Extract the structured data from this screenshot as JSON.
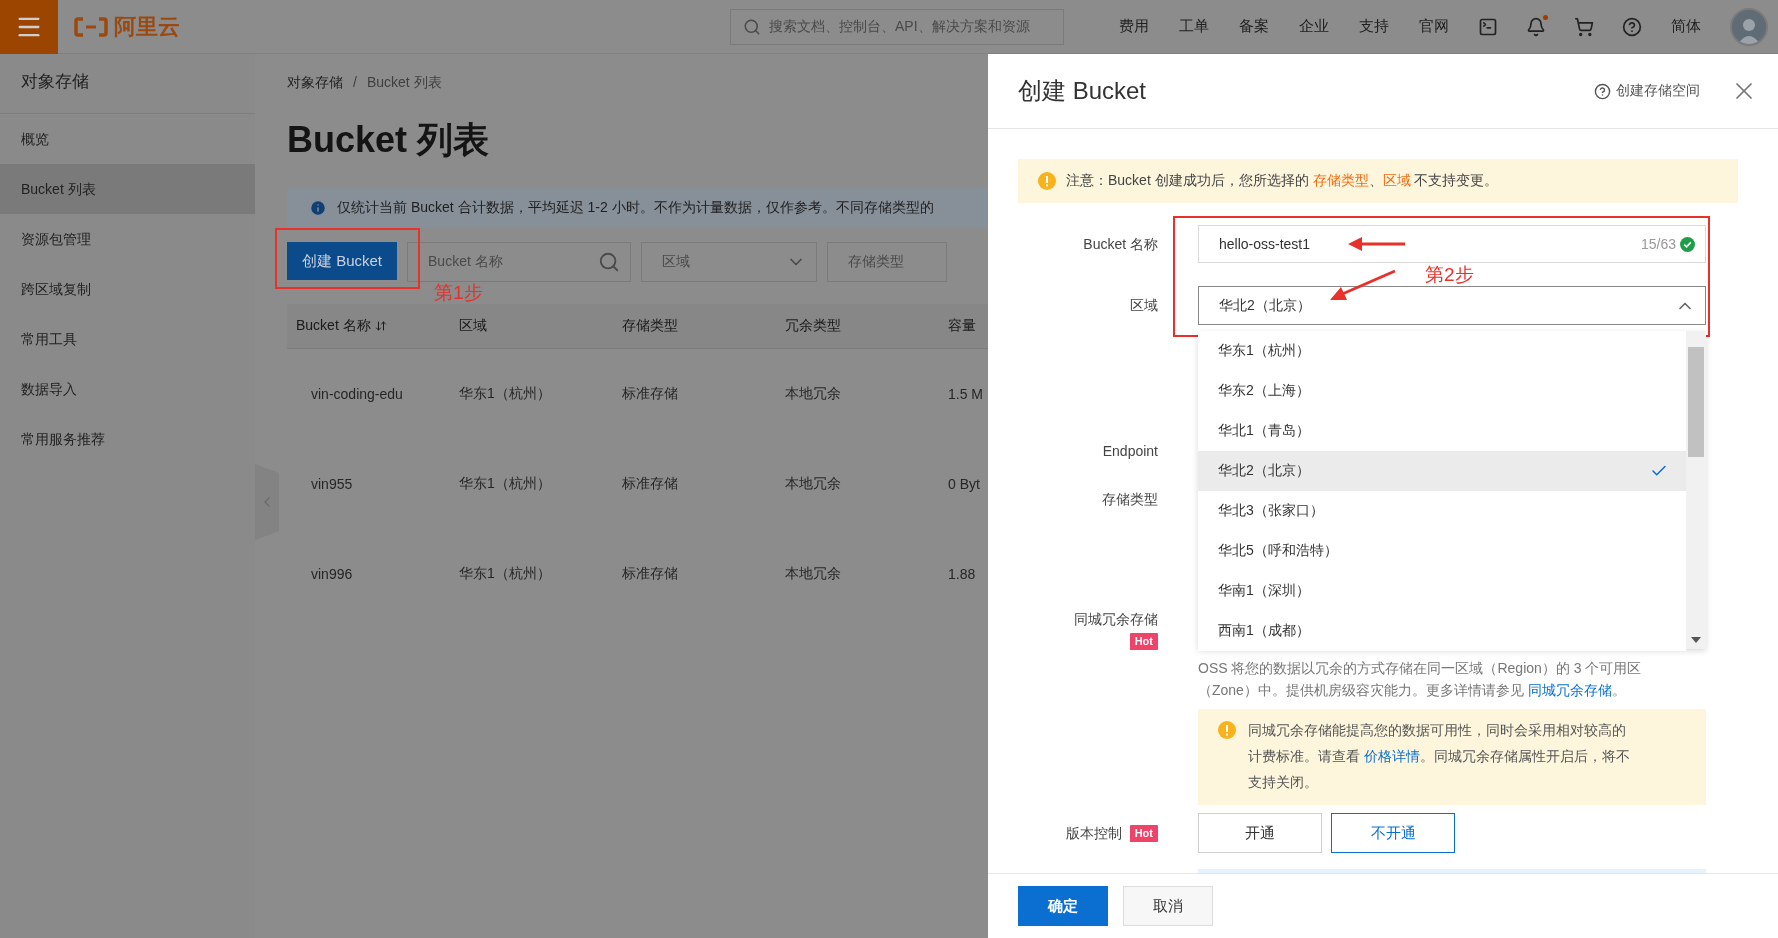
{
  "top_bar": {
    "logo": "阿里云",
    "search": {
      "placeholder": "搜索文档、控制台、API、解决方案和资源"
    },
    "nav": [
      "费用",
      "工单",
      "备案",
      "企业",
      "支持",
      "官网"
    ],
    "language": "简体"
  },
  "sidebar": {
    "title": "对象存储",
    "items": [
      {
        "label": "概览",
        "selected": false
      },
      {
        "label": "Bucket 列表",
        "selected": true
      },
      {
        "label": "资源包管理",
        "selected": false
      },
      {
        "label": "跨区域复制",
        "selected": false
      },
      {
        "label": "常用工具",
        "selected": false
      },
      {
        "label": "数据导入",
        "selected": false
      },
      {
        "label": "常用服务推荐",
        "selected": false
      }
    ]
  },
  "breadcrumb": {
    "items": [
      "对象存储",
      "Bucket 列表"
    ],
    "separator": "/"
  },
  "page_title": "Bucket 列表",
  "info_banner": "仅统计当前 Bucket 合计数据，平均延迟 1-2 小时。不作为计量数据，仅作参考。不同存储类型的",
  "toolbar": {
    "create_button": "创建 Bucket",
    "search": {
      "placeholder": "Bucket 名称"
    },
    "filters": [
      {
        "label": "区域",
        "kind": "select"
      },
      {
        "label": "存储类型",
        "kind": "plain"
      }
    ]
  },
  "table": {
    "columns": [
      {
        "label": "Bucket 名称",
        "sortable": true
      },
      {
        "label": "区域",
        "sortable": false
      },
      {
        "label": "存储类型",
        "sortable": false
      },
      {
        "label": "冗余类型",
        "sortable": false
      },
      {
        "label": "容量",
        "sortable": false
      }
    ],
    "rows": [
      [
        "vin-coding-edu",
        "华东1（杭州）",
        "标准存储",
        "本地冗余",
        "1.5 M"
      ],
      [
        "vin955",
        "华东1（杭州）",
        "标准存储",
        "本地冗余",
        "0 Byt"
      ],
      [
        "vin996",
        "华东1（杭州）",
        "标准存储",
        "本地冗余",
        "1.88"
      ]
    ]
  },
  "step_labels": [
    "第1步",
    "第2步"
  ],
  "drawer": {
    "title": "创建 Bucket",
    "help_link": "创建存储空间",
    "notice": [
      {
        "kind": "text",
        "text": "注意：Bucket 创建成功后，您所选择的 "
      },
      {
        "kind": "highlight",
        "text": "存储类型"
      },
      {
        "kind": "text",
        "text": "、"
      },
      {
        "kind": "highlight",
        "text": "区域"
      },
      {
        "kind": "text",
        "text": " 不支持变更。"
      }
    ],
    "name_field": {
      "label": "Bucket 名称",
      "value": "hello-oss-test1",
      "counter": "15/63",
      "valid": true
    },
    "region_field": {
      "label": "区域",
      "value": "华北2（北京）",
      "expanded": true,
      "options": [
        {
          "label": "华东1（杭州）",
          "selected": false
        },
        {
          "label": "华东2（上海）",
          "selected": false
        },
        {
          "label": "华北1（青岛）",
          "selected": false
        },
        {
          "label": "华北2（北京）",
          "selected": true
        },
        {
          "label": "华北3（张家口）",
          "selected": false
        },
        {
          "label": "华北5（呼和浩特）",
          "selected": false
        },
        {
          "label": "华南1（深圳）",
          "selected": false
        },
        {
          "label": "西南1（成都）",
          "selected": false
        }
      ]
    },
    "endpoint_label": "Endpoint",
    "storage_class_label": "存储类型",
    "redundancy": {
      "label": "同城冗余存储",
      "badge": "Hot",
      "description": [
        {
          "kind": "text",
          "text": "OSS 将您的数据以冗余的方式存储在同一区域（Region）的 3 个可用区（Zone）中。提供机房级容灾能力。更多详情请参见 "
        },
        {
          "kind": "link",
          "text": "同城冗余存储"
        },
        {
          "kind": "text",
          "text": "。"
        }
      ],
      "warning": [
        {
          "kind": "text",
          "text": "同城冗余存储能提高您的数据可用性，同时会采用相对较高的计费标准。请查看 "
        },
        {
          "kind": "link",
          "text": "价格详情"
        },
        {
          "kind": "text",
          "text": "。同城冗余存储属性开启后，将不支持关闭。"
        }
      ]
    },
    "versioning": {
      "label": "版本控制",
      "badge": "Hot",
      "options": [
        {
          "label": "开通",
          "selected": false
        },
        {
          "label": "不开通",
          "selected": true
        }
      ]
    },
    "footer_buttons": [
      {
        "label": "确定",
        "kind": "primary"
      },
      {
        "label": "取消",
        "kind": "default"
      }
    ]
  }
}
